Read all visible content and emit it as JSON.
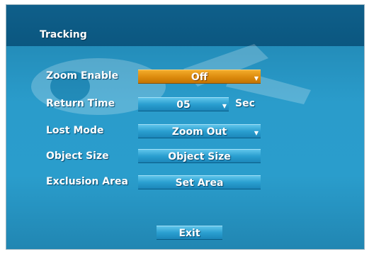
{
  "title": "Tracking",
  "rows": [
    {
      "label": "Zoom Enable",
      "value": "Off",
      "dropdown": true
    },
    {
      "label": "Return Time",
      "value": "05",
      "dropdown": true,
      "unit": "Sec"
    },
    {
      "label": "Lost Mode",
      "value": "Zoom Out",
      "dropdown": true
    },
    {
      "label": "Object Size",
      "value": "Object Size",
      "dropdown": false
    },
    {
      "label": "Exclusion Area",
      "value": "Set Area",
      "dropdown": false
    }
  ],
  "exit_label": "Exit",
  "colors": {
    "panel": "#2a9ccb",
    "titlebar": "#0f5f8a",
    "selected_field": "#dc8a0d",
    "field": "#2a9fd0"
  }
}
